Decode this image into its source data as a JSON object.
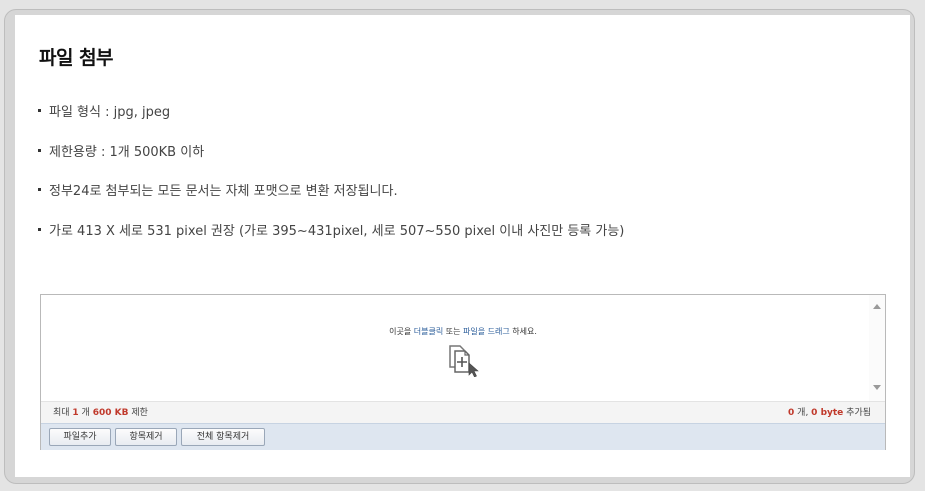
{
  "page": {
    "title": "파일 첨부"
  },
  "info_items": [
    "파일 형식 : jpg, jpeg",
    "제한용량 : 1개 500KB 이하",
    "정부24로 첨부되는 모든 문서는 자체 포맷으로 변환 저장됩니다.",
    "가로 413 X 세로 531 pixel 권장 (가로 395~431pixel, 세로 507~550 pixel 이내 사진만 등록 가능)"
  ],
  "dropzone": {
    "hint_prefix": "이곳을 ",
    "hint_link1": "더블클릭",
    "hint_mid": " 또는 ",
    "hint_link2": "파일을 드래그",
    "hint_suffix": " 하세요.",
    "icon": "add-file-icon"
  },
  "status": {
    "limit_prefix": "최대 ",
    "limit_count": "1",
    "limit_unit": " 개 ",
    "limit_size": "600 KB",
    "limit_suffix": " 제한",
    "added_count": "0",
    "added_count_unit": " 개, ",
    "added_bytes": "0 byte",
    "added_suffix": " 추가됨"
  },
  "buttons": {
    "add_file": "파일추가",
    "remove_item": "항목제거",
    "remove_all": "전체 항목제거"
  },
  "colors": {
    "accent_red": "#c0392b",
    "link_blue": "#2a5c9a",
    "button_bar": "#dee6f0"
  }
}
